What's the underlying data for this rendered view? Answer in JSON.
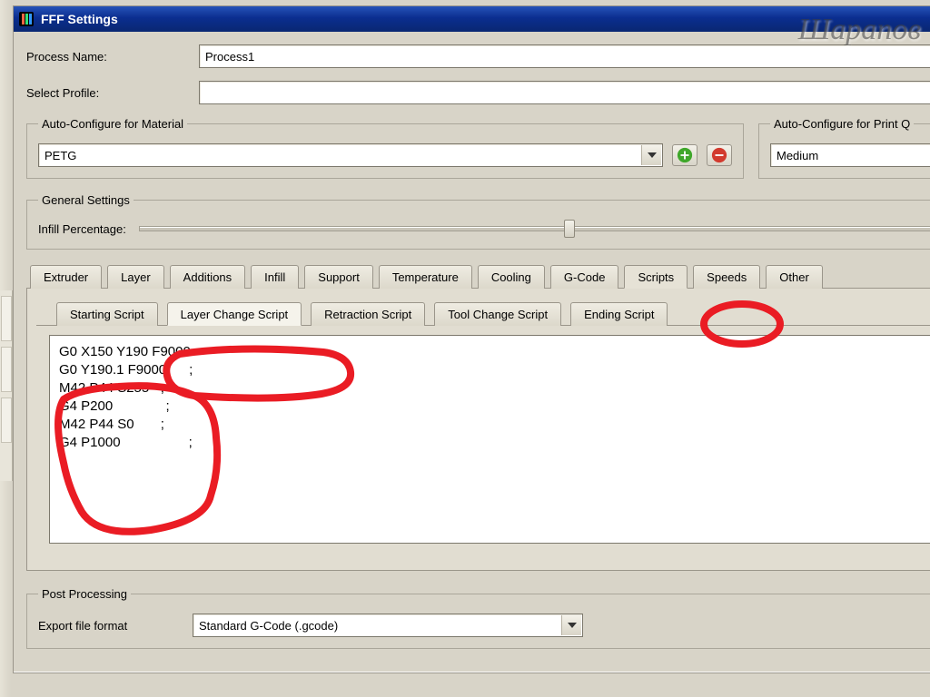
{
  "window": {
    "title": "FFF Settings"
  },
  "watermark": "Шарапов",
  "fields": {
    "process_name_label": "Process Name:",
    "process_name_value": "Process1",
    "select_profile_label": "Select Profile:",
    "select_profile_value": ""
  },
  "material_group": {
    "legend": "Auto-Configure for Material",
    "value": "PETG"
  },
  "quality_group": {
    "legend": "Auto-Configure for Print Q",
    "value": "Medium"
  },
  "general_group": {
    "legend": "General Settings",
    "infill_label": "Infill Percentage:"
  },
  "tabs": {
    "main": [
      "Extruder",
      "Layer",
      "Additions",
      "Infill",
      "Support",
      "Temperature",
      "Cooling",
      "G-Code",
      "Scripts",
      "Speeds",
      "Other"
    ],
    "main_active_index": 8,
    "scripts": [
      "Starting Script",
      "Layer Change Script",
      "Retraction Script",
      "Tool Change Script",
      "Ending Script"
    ],
    "scripts_active_index": 1
  },
  "script_text": "G0 X150 Y190 F9000\nG0 Y190.1 F9000      ;\nM42 P44 S255   ;\nG4 P200              ;\nM42 P44 S0       ;\nG4 P1000                  ;\n",
  "post_group": {
    "legend": "Post Processing",
    "export_label": "Export file format",
    "export_value": "Standard G-Code (.gcode)"
  }
}
